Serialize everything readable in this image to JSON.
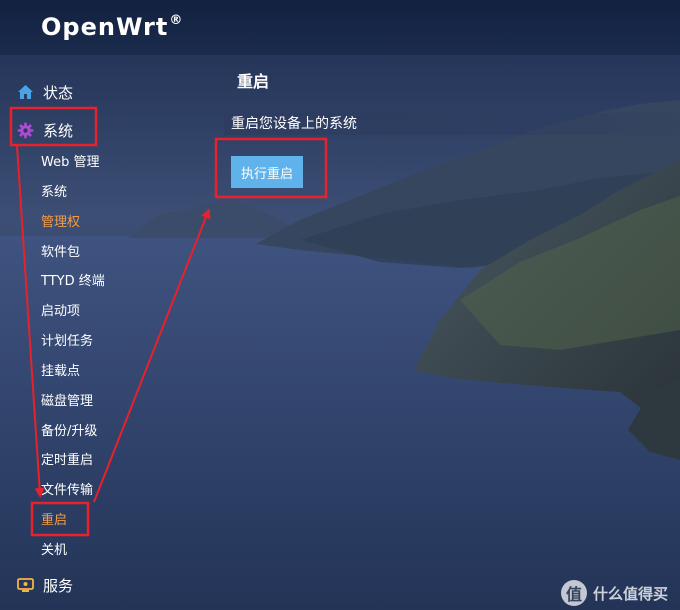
{
  "header": {
    "brand": "OpenWrt",
    "trademark": "®"
  },
  "sidebar": {
    "status_label": "状态",
    "system_label": "系统",
    "services_label": "服务",
    "sub_items": [
      {
        "label": "Web 管理",
        "active": false
      },
      {
        "label": "系统",
        "active": false
      },
      {
        "label": "管理权",
        "active": true
      },
      {
        "label": "软件包",
        "active": false
      },
      {
        "label": "TTYD 终端",
        "active": false
      },
      {
        "label": "启动项",
        "active": false
      },
      {
        "label": "计划任务",
        "active": false
      },
      {
        "label": "挂载点",
        "active": false
      },
      {
        "label": "磁盘管理",
        "active": false
      },
      {
        "label": "备份/升级",
        "active": false
      },
      {
        "label": "定时重启",
        "active": false
      },
      {
        "label": "文件传输",
        "active": false
      },
      {
        "label": "重启",
        "active": true
      },
      {
        "label": "关机",
        "active": false
      }
    ]
  },
  "main": {
    "title": "重启",
    "description": "重启您设备上的系统",
    "reboot_button": "执行重启"
  },
  "watermark": {
    "glyph": "值",
    "text": "什么值得买"
  },
  "colors": {
    "header_bg": "#12213f",
    "active_item": "#f39c4a",
    "button_bg": "#5fb3ea",
    "annotation_red": "#e8212b",
    "status_icon": "#4aa3e6",
    "system_icon": "#b04ad6"
  }
}
